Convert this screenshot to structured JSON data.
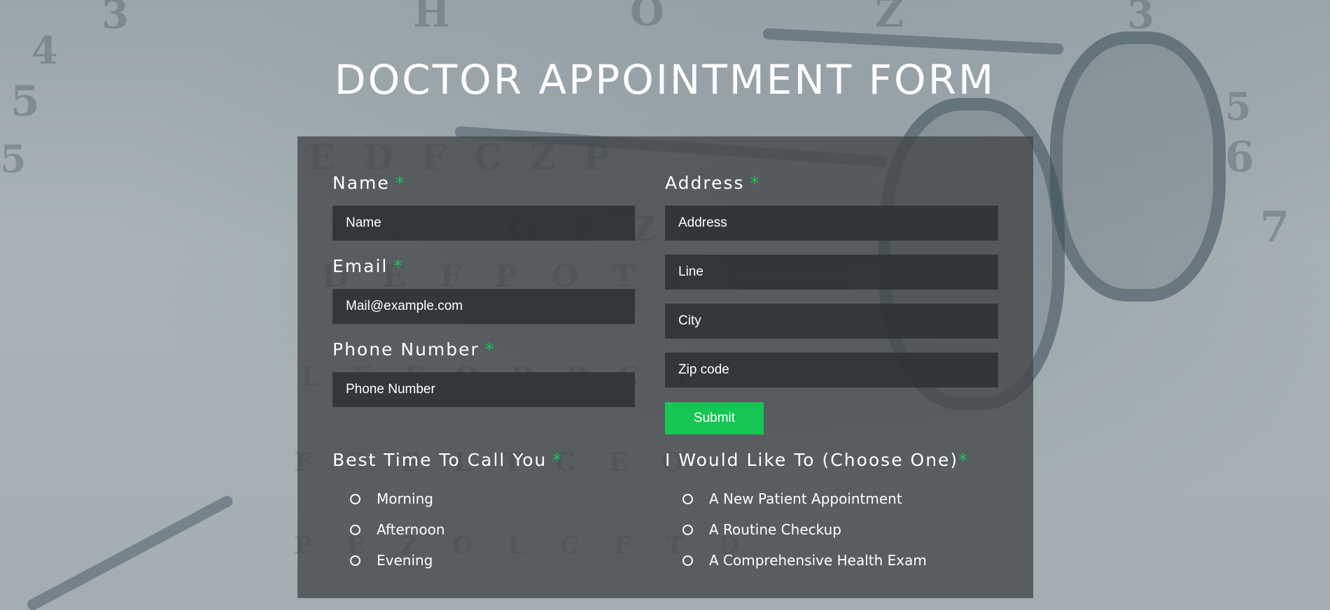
{
  "page": {
    "title": "DOCTOR APPOINTMENT FORM"
  },
  "colors": {
    "accent": "#16c654",
    "required_marker": "#18c45a",
    "panel": "#424648",
    "input_bg": "#2d3032"
  },
  "form": {
    "required_marker": "*",
    "name": {
      "label": "Name",
      "placeholder": "Name",
      "value": ""
    },
    "email": {
      "label": "Email",
      "placeholder": "Mail@example.com",
      "value": ""
    },
    "phone": {
      "label": "Phone Number",
      "placeholder": "Phone Number",
      "value": ""
    },
    "address": {
      "label": "Address",
      "line1_placeholder": "Address",
      "line2_placeholder": "Line",
      "city_placeholder": "City",
      "zip_placeholder": "Zip code"
    },
    "submit_label": "Submit",
    "best_time": {
      "label": "Best Time To Call You",
      "options": [
        "Morning",
        "Afternoon",
        "Evening"
      ]
    },
    "purpose": {
      "label": "I Would Like To (Choose One)",
      "options": [
        "A New Patient Appointment",
        "A Routine Checkup",
        "A Comprehensive Health Exam"
      ]
    }
  }
}
